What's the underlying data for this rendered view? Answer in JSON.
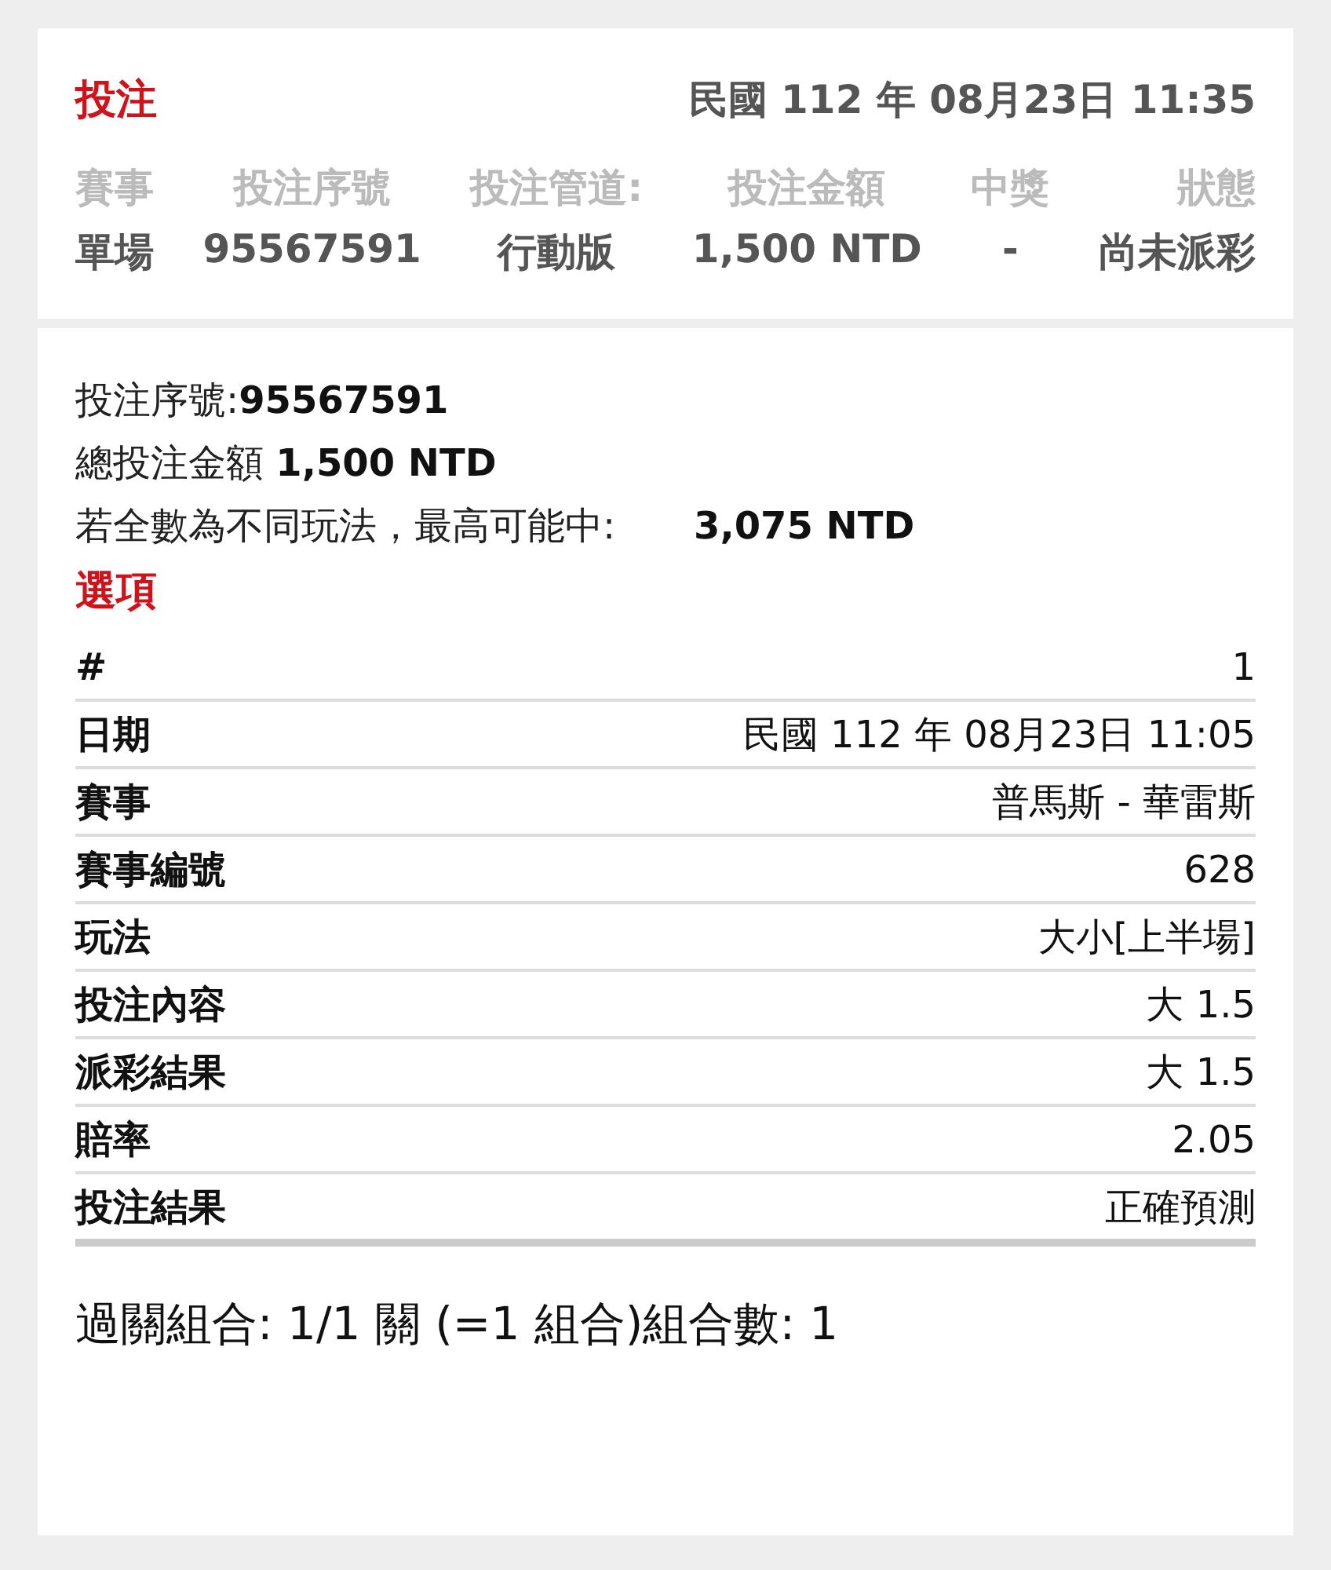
{
  "header": {
    "title": "投注",
    "datetime": "民國 112 年 08月23日 11:35"
  },
  "summary_table": {
    "columns": [
      "賽事",
      "投注序號",
      "投注管道:",
      "投注金額",
      "中獎",
      "狀態"
    ],
    "values": [
      "單場",
      "95567591",
      "行動版",
      "1,500 NTD",
      "-",
      "尚未派彩"
    ]
  },
  "details": {
    "lines": [
      "投注序號:**95567591**",
      "總投注金額 **1,500 NTD**"
    ],
    "max_win": {
      "label": "若全數為不同玩法，最高可能中:",
      "value": "3,075 NTD"
    }
  },
  "options": {
    "title": "選項",
    "rows": [
      {
        "label": "#",
        "value": "1"
      },
      {
        "label": "日期",
        "value": "民國 112 年 08月23日 11:05"
      },
      {
        "label": "賽事",
        "value": "普馬斯 - 華雷斯"
      },
      {
        "label": "賽事編號",
        "value": "628"
      },
      {
        "label": "玩法",
        "value": "大小[上半場]"
      },
      {
        "label": "投注內容",
        "value": "大 1.5"
      },
      {
        "label": "派彩結果",
        "value": "大 1.5"
      },
      {
        "label": "賠率",
        "value": "2.05"
      },
      {
        "label": "投注結果",
        "value": "正確預測"
      }
    ]
  },
  "combination": "過關組合: 1/1 關 (=1 組合)組合數: 1"
}
